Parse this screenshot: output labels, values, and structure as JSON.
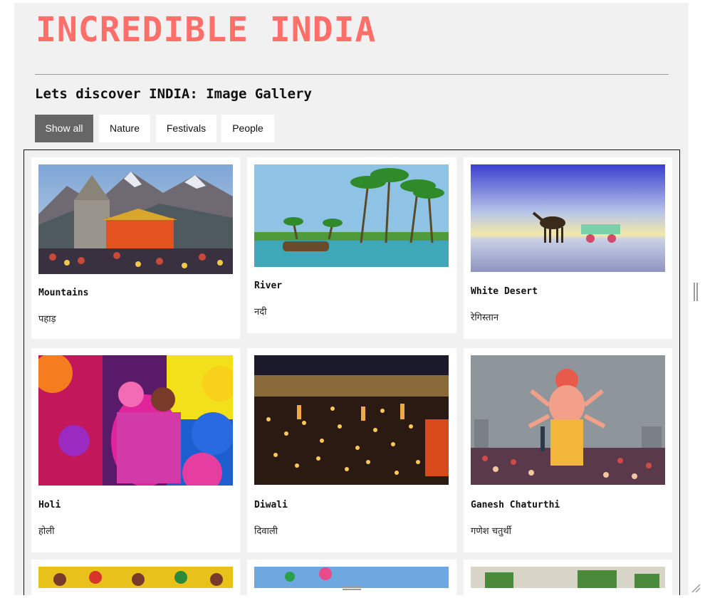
{
  "header": {
    "title": "INCREDIBLE INDIA",
    "subtitle": "Lets discover INDIA: Image Gallery"
  },
  "filters": [
    {
      "label": "Show all",
      "active": true
    },
    {
      "label": "Nature",
      "active": false
    },
    {
      "label": "Festivals",
      "active": false
    },
    {
      "label": "People",
      "active": false
    }
  ],
  "gallery": {
    "cards": [
      {
        "title": "Mountains",
        "desc": "पहाड़",
        "image": "temple-mountain-photo"
      },
      {
        "title": "River",
        "desc": "नदी",
        "image": "backwater-palm-photo"
      },
      {
        "title": "White Desert",
        "desc": "रेगिस्तान",
        "image": "camel-desert-photo"
      },
      {
        "title": "Holi",
        "desc": "होली",
        "image": "holi-colors-photo"
      },
      {
        "title": "Diwali",
        "desc": "दिवाली",
        "image": "diwali-lamps-photo"
      },
      {
        "title": "Ganesh Chaturthi",
        "desc": "गणेश चतुर्थी",
        "image": "ganesh-idol-photo"
      }
    ]
  },
  "colors": {
    "title": "#ff6f6a",
    "active_filter_bg": "#666666",
    "page_bg": "#f1f1f1"
  }
}
